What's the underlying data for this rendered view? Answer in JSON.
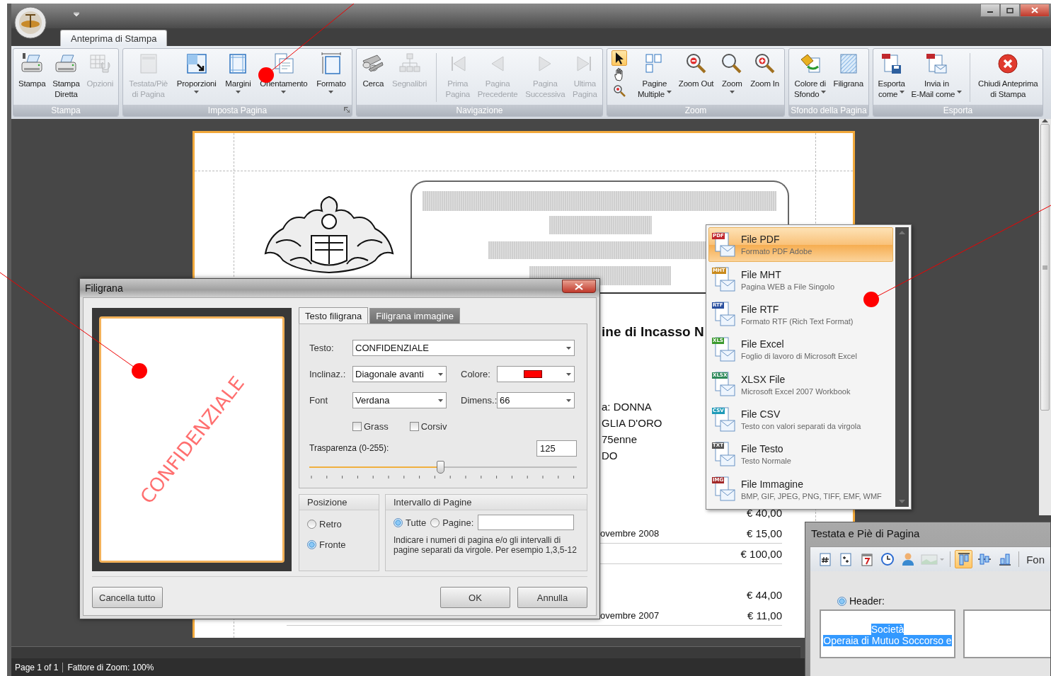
{
  "window": {
    "tab": {
      "label": "Anteprima di Stampa",
      "selected": true
    }
  },
  "ribbon": {
    "groups": [
      {
        "label": "Stampa",
        "launcher": false,
        "buttons": [
          {
            "label": "Stampa",
            "disabled": false,
            "dropdown": false,
            "separator_before": false
          },
          {
            "label": "Stampa\nDiretta",
            "disabled": false,
            "dropdown": false,
            "separator_before": false
          },
          {
            "label": "Opzioni",
            "disabled": true,
            "dropdown": false,
            "separator_before": false
          }
        ]
      },
      {
        "label": "Imposta Pagina",
        "launcher": true,
        "buttons": [
          {
            "label": "Testata/Piè\ndi Pagina",
            "disabled": true,
            "dropdown": false,
            "separator_before": false
          },
          {
            "label": "Proporzioni",
            "disabled": false,
            "dropdown": true,
            "separator_before": false
          },
          {
            "label": "Margini",
            "disabled": false,
            "dropdown": true,
            "separator_before": false
          },
          {
            "label": "Orientamento",
            "disabled": false,
            "dropdown": true,
            "separator_before": false
          },
          {
            "label": "Formato",
            "disabled": false,
            "dropdown": true,
            "separator_before": false
          }
        ]
      },
      {
        "label": "Navigazione",
        "launcher": false,
        "buttons": [
          {
            "label": "Cerca",
            "disabled": false,
            "dropdown": false,
            "separator_before": false
          },
          {
            "label": "Segnalibri",
            "disabled": true,
            "dropdown": false,
            "separator_before": false
          },
          {
            "label": "Prima\nPagina",
            "disabled": true,
            "dropdown": false,
            "separator_before": true
          },
          {
            "label": "Pagina\nPrecedente",
            "disabled": true,
            "dropdown": false,
            "separator_before": false
          },
          {
            "label": "Pagina\nSuccessiva",
            "disabled": true,
            "dropdown": false,
            "separator_before": false
          },
          {
            "label": "Ultima\nPagina",
            "disabled": true,
            "dropdown": false,
            "separator_before": false
          }
        ]
      },
      {
        "label": "Zoom",
        "launcher": false,
        "tools": [
          {
            "selected": true
          },
          {
            "selected": false
          },
          {
            "selected": false
          }
        ],
        "buttons": [
          {
            "label": "Pagine\nMultiple",
            "disabled": false,
            "dropdown": true,
            "separator_before": false
          },
          {
            "label": "Zoom Out",
            "disabled": false,
            "dropdown": false,
            "separator_before": false
          },
          {
            "label": "Zoom",
            "disabled": false,
            "dropdown": true,
            "separator_before": false
          },
          {
            "label": "Zoom In",
            "disabled": false,
            "dropdown": false,
            "separator_before": false
          }
        ]
      },
      {
        "label": "Sfondo della Pagina",
        "launcher": false,
        "buttons": [
          {
            "label": "Colore di\nSfondo",
            "disabled": false,
            "dropdown": true,
            "separator_before": false
          },
          {
            "label": "Filigrana",
            "disabled": false,
            "dropdown": false,
            "separator_before": false
          }
        ]
      },
      {
        "label": "Esporta",
        "launcher": false,
        "buttons": [
          {
            "label": "Esporta\ncome",
            "disabled": false,
            "dropdown": true,
            "separator_before": false
          },
          {
            "label": "Invia in\nE-Mail come",
            "disabled": false,
            "dropdown": true,
            "separator_before": false
          },
          {
            "label": "Chiudi Anteprima\ndi Stampa",
            "disabled": false,
            "dropdown": false,
            "separator_before": true
          }
        ]
      }
    ]
  },
  "document": {
    "title": "ine di Incasso N",
    "info_lines": [
      "a: DONNA",
      "GLIA D'ORO",
      "75enne",
      "DO"
    ],
    "rows": [
      {
        "amount": "€ 40,00",
        "rule": false
      },
      {
        "date": "ovembre 2008",
        "amount": "€ 15,00",
        "rule": true
      },
      {
        "amount": "€ 100,00",
        "rule": true
      },
      {
        "amount": "€ 44,00",
        "rule": false
      },
      {
        "date": "ovembre 2007",
        "amount": "€ 11,00",
        "rule": true
      }
    ]
  },
  "status_bar": {
    "page": "Page 1 of 1",
    "zoom": "Fattore di Zoom: 100%"
  },
  "watermark_dialog": {
    "title": "Filigrana",
    "preview_text": "CONFIDENZIALE",
    "tabs": [
      {
        "label": "Testo filigrana",
        "selected": true
      },
      {
        "label": "Filigrana immagine",
        "selected": false
      }
    ],
    "text": {
      "label": "Testo:",
      "value": "CONFIDENZIALE"
    },
    "angle": {
      "label": "Inclinaz.:",
      "value": "Diagonale avanti"
    },
    "color": {
      "label": "Colore:",
      "color": "#ff0000"
    },
    "font": {
      "label": "Font",
      "value": "Verdana"
    },
    "size": {
      "label": "Dimens.:",
      "value": "66"
    },
    "checks": [
      {
        "label": "Grass",
        "checked": false
      },
      {
        "label": "Corsiv",
        "checked": false
      }
    ],
    "transparency": {
      "label": "Trasparenza (0-255):",
      "value": "125",
      "level": 0.49
    },
    "position": {
      "title": "Posizione",
      "options": [
        {
          "label": "Retro",
          "selected": false
        },
        {
          "label": "Fronte",
          "selected": true
        }
      ]
    },
    "range": {
      "title": "Intervallo di Pagine",
      "options": [
        {
          "label": "Tutte",
          "selected": true
        },
        {
          "label": "Pagine:",
          "selected": false
        }
      ],
      "hint": "Indicare i numeri di pagina e/o gli intervalli di pagine separati da virgole. Per esempio 1,3,5-12"
    },
    "buttons": [
      {
        "label": "Cancella tutto",
        "kind": "left"
      },
      {
        "label": "OK",
        "kind": "right"
      },
      {
        "label": "Annulla",
        "kind": "right"
      }
    ]
  },
  "export_menu": {
    "items": [
      {
        "title": "File PDF",
        "subtitle": "Formato PDF Adobe",
        "badge": "PDF",
        "color": "#c0282d",
        "selected": true
      },
      {
        "title": "File MHT",
        "subtitle": "Pagina WEB a File Singolo",
        "badge": "MHT",
        "color": "#c98a1c",
        "selected": false
      },
      {
        "title": "File RTF",
        "subtitle": "Formato RTF (Rich Text Format)",
        "badge": "RTF",
        "color": "#2a4f9e",
        "selected": false
      },
      {
        "title": "File Excel",
        "subtitle": "Foglio di lavoro di Microsoft Excel",
        "badge": "XLS",
        "color": "#3c9a2e",
        "selected": false
      },
      {
        "title": "XLSX File",
        "subtitle": "Microsoft Excel 2007 Workbook",
        "badge": "XLSX",
        "color": "#2e8a5a",
        "selected": false
      },
      {
        "title": "File CSV",
        "subtitle": "Testo con valori separati da virgola",
        "badge": "CSV",
        "color": "#1f9bb8",
        "selected": false
      },
      {
        "title": "File Testo",
        "subtitle": "Testo Normale",
        "badge": "TXT",
        "color": "#555555",
        "selected": false
      },
      {
        "title": "File Immagine",
        "subtitle": "BMP, GIF, JPEG, PNG, TIFF, EMF, WMF",
        "badge": "IMG",
        "color": "#a32a2a",
        "selected": false
      }
    ]
  },
  "header_footer_panel": {
    "title": "Testata e Piè di Pagina",
    "toolbar": [
      {
        "selected": false,
        "disabled": false
      },
      {
        "selected": false,
        "disabled": false
      },
      {
        "selected": false,
        "disabled": false
      },
      {
        "selected": false,
        "disabled": false
      },
      {
        "selected": false,
        "disabled": false
      },
      {
        "selected": false,
        "disabled": true
      },
      {
        "selected": true,
        "disabled": false
      },
      {
        "selected": false,
        "disabled": false
      },
      {
        "selected": false,
        "disabled": false
      }
    ],
    "font_label": "Fon",
    "header": {
      "label": "Header:",
      "selected": true,
      "lines": [
        "Società",
        "Operaia di Mutuo Soccorso e"
      ]
    }
  },
  "callouts": [
    {
      "kind": "dot"
    },
    {
      "kind": "dot"
    },
    {
      "kind": "dot"
    }
  ]
}
